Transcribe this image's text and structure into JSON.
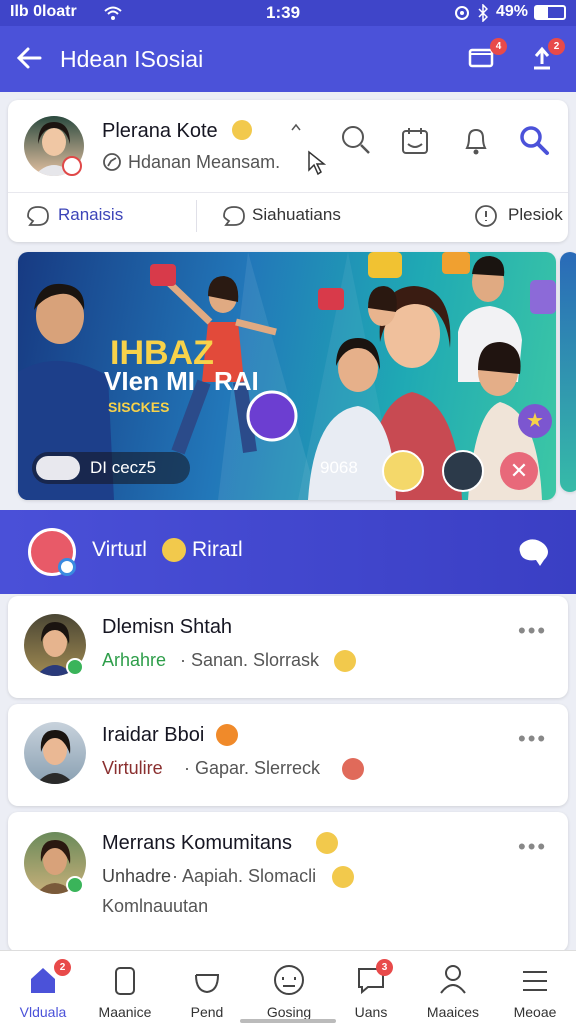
{
  "status_bar": {
    "carrier": "Ilb 0loatr",
    "time": "1:39",
    "battery": "49%"
  },
  "header": {
    "title": "Hdean ISosiai",
    "notif_count": "4",
    "upload_count": "2"
  },
  "profile": {
    "name": "Plerana Kote",
    "subtitle": "Hdanan Meansam.",
    "tabs": [
      "Ranaisis",
      "Siahuatians",
      "Plesiok"
    ]
  },
  "banner": {
    "headline_1": "IHBAZ",
    "headline_2": "VIen MI",
    "headline_3": "RAI",
    "headline_4": "SISCKES",
    "left_chip": "DI cecz5",
    "right_chip": "9068",
    "colors": {
      "bg_start": "#1b5fae",
      "bg_end": "#34c8c9"
    }
  },
  "section": {
    "title": "Virtuɪl",
    "title_2": "Riraɪl"
  },
  "feed": [
    {
      "name": "Dlemisn Shtah",
      "tag": "Arhahre",
      "detail": "· Sanan. Slorrask",
      "tag_color": "#2e9e4a",
      "extra": ""
    },
    {
      "name": "Iraidar Bboi",
      "tag": "Virtulire",
      "detail": "· Gapar. Slerreck",
      "tag_color": "#8a2f2f",
      "extra": ""
    },
    {
      "name": "Merrans Komumitans",
      "tag": "Unhadre",
      "detail": "· Aapiah. Slomacli",
      "tag_color": "#444444",
      "extra": "Komlnauutan"
    }
  ],
  "nav": [
    {
      "label": "Vlduala",
      "icon": "home-icon",
      "badge": "2",
      "active": true
    },
    {
      "label": "Maanice",
      "icon": "phone-icon",
      "badge": "",
      "active": false
    },
    {
      "label": "Pend",
      "icon": "bowl-icon",
      "badge": "",
      "active": false
    },
    {
      "label": "Gosing",
      "icon": "face-icon",
      "badge": "",
      "active": false
    },
    {
      "label": "Uans",
      "icon": "chat-icon",
      "badge": "3",
      "active": false
    },
    {
      "label": "Maaices",
      "icon": "user-icon",
      "badge": "",
      "active": false
    },
    {
      "label": "Meoae",
      "icon": "menu-icon",
      "badge": "",
      "active": false
    }
  ],
  "colors": {
    "primary": "#4b52d9",
    "status": "#3f45c9",
    "badge": "#e84a4a"
  }
}
